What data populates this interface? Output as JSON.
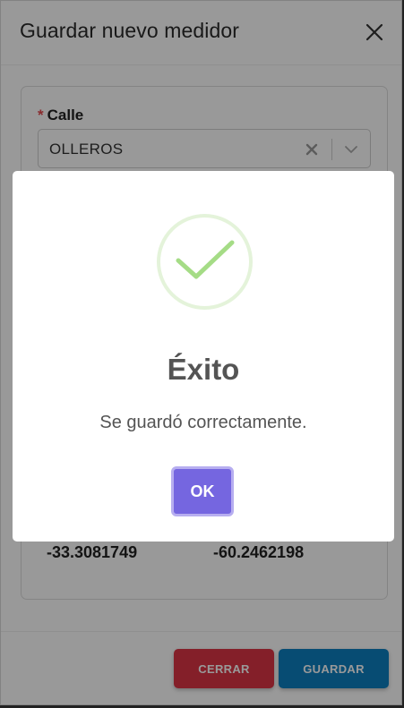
{
  "modal": {
    "title": "Guardar nuevo medidor",
    "field": {
      "required_mark": "*",
      "label": "Calle",
      "value": "OLLEROS"
    },
    "coordinates": {
      "latitude": "-33.3081749",
      "longitude": "-60.2462198"
    },
    "buttons": {
      "cerrar": "CERRAR",
      "guardar": "GUARDAR"
    }
  },
  "alert": {
    "icon": "success-check-icon",
    "title": "Éxito",
    "text": "Se guardó correctamente.",
    "ok_label": "OK"
  },
  "colors": {
    "accent_ok": "#7566e0",
    "cerrar": "#dc3545",
    "guardar": "#0d7fc0",
    "success": "#a5dc86"
  }
}
